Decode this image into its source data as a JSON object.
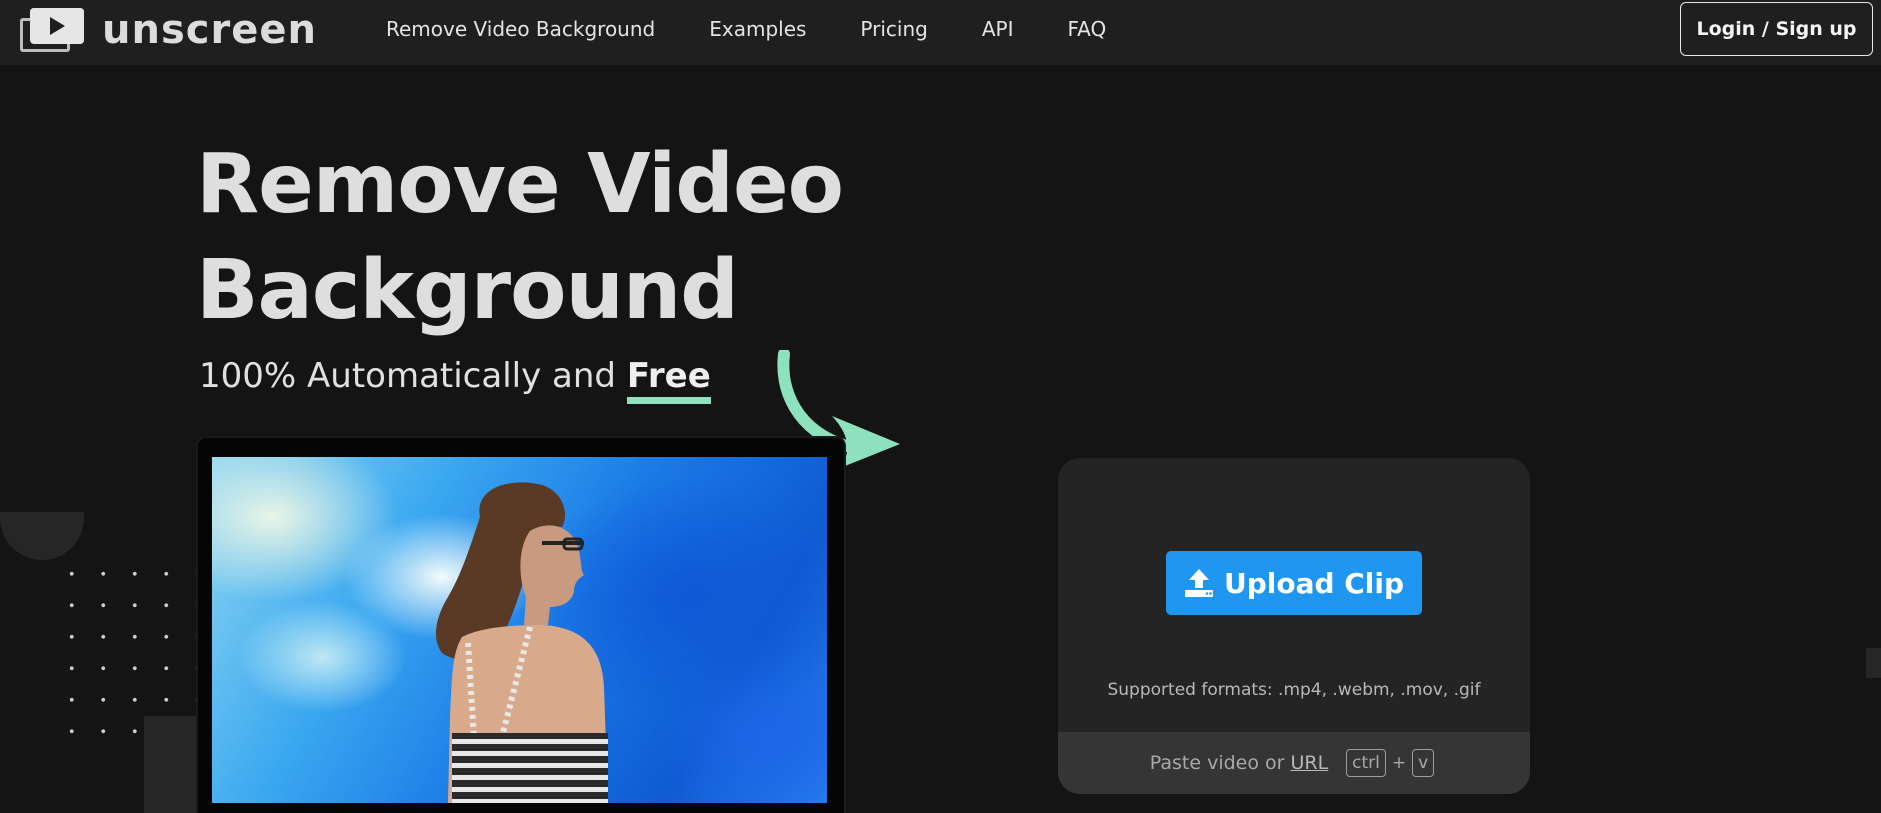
{
  "nav": {
    "brand": "unscreen",
    "links": [
      "Remove Video Background",
      "Examples",
      "Pricing",
      "API",
      "FAQ"
    ],
    "login_label": "Login / Sign up"
  },
  "hero": {
    "title": "Remove Video Background",
    "subtitle_prefix": "100% Automatically and",
    "subtitle_emphasis": "Free"
  },
  "upload": {
    "button_label": "Upload Clip",
    "formats": "Supported formats: .mp4, .webm, .mov, .gif",
    "paste_prefix": "Paste video or",
    "paste_link": "URL",
    "key_ctrl": "ctrl",
    "key_plus": "+",
    "key_v": "v"
  },
  "colors": {
    "background": "#141414",
    "navbar": "#1f1f1f",
    "accent_green": "#8de1bd",
    "button_blue": "#1f96f0",
    "card": "#242424"
  },
  "icons": {
    "logo": "play-screen-icon",
    "upload": "upload-icon",
    "arrow": "curved-arrow-icon"
  }
}
